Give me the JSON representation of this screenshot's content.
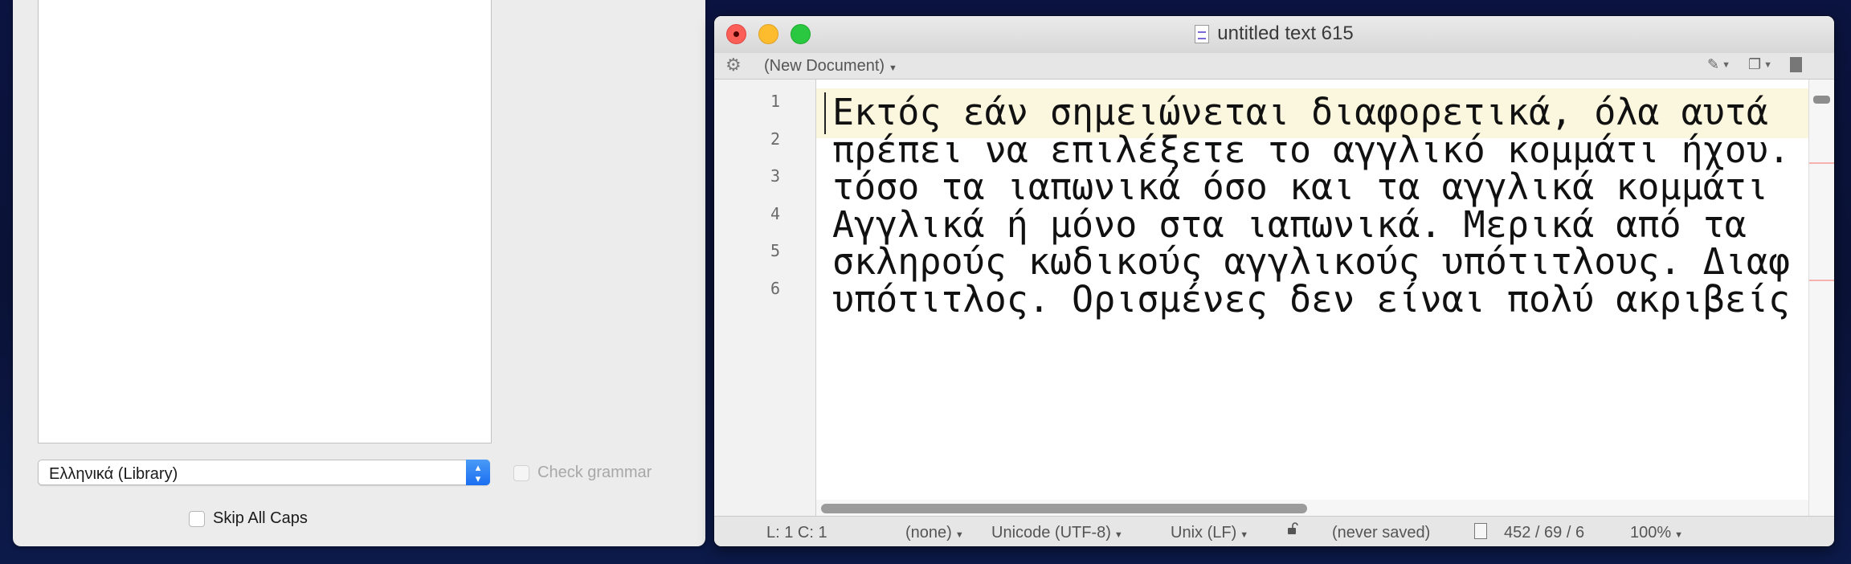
{
  "spelling_panel": {
    "language_select": "Ελληνικά (Library)",
    "check_grammar_label": "Check grammar",
    "skip_all_caps_label": "Skip All Caps"
  },
  "window": {
    "title": "untitled text 615",
    "toolbar": {
      "document_menu": "(New Document)"
    },
    "editor": {
      "line_numbers": [
        "1",
        "2",
        "3",
        "4",
        "5",
        "6"
      ],
      "lines": [
        "Εκτός εάν σημειώνεται διαφορετικά, όλα αυτά",
        "πρέπει να επιλέξετε το αγγλικό κομμάτι ήχου. Μ",
        "τόσο τα ιαπωνικά όσο και τα αγγλικά κομμάτι",
        "Αγγλικά ή μόνο στα ιαπωνικά. Μερικά από τα",
        "σκληρούς κωδικούς αγγλικούς υπότιτλους. Διαφ",
        "υπότιτλος. Ορισμένες δεν είναι πολύ ακριβείς σ"
      ]
    },
    "status": {
      "position": "L: 1 C: 1",
      "syntax": "(none)",
      "encoding": "Unicode (UTF-8)",
      "line_endings": "Unix (LF)",
      "saved_state": "(never saved)",
      "counts": "452 / 69 / 6",
      "zoom": "100%"
    }
  }
}
